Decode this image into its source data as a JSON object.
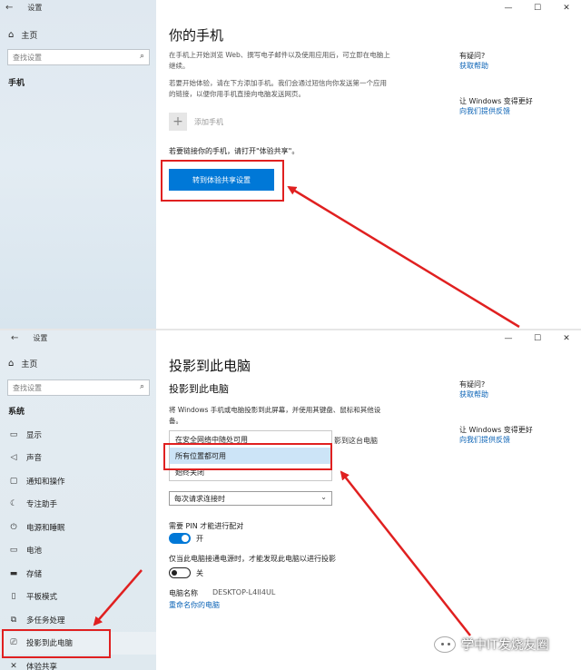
{
  "top": {
    "window_title": "设置",
    "home_label": "主页",
    "search_placeholder": "查找设置",
    "category": "手机",
    "page_title": "你的手机",
    "para1": "在手机上开始浏览 Web、撰写电子邮件以及使用应用后，可立即在电脑上继续。",
    "para2": "若要开始体验，请在下方添加手机。我们会通过短信向你发送第一个应用的链接，以便你用手机直接向电脑发送网页。",
    "add_phone_label": "添加手机",
    "share_hint": "若要链接你的手机，请打开\"体验共享\"。",
    "share_button": "转到体验共享设置",
    "help_title": "有疑问?",
    "help_link": "获取帮助",
    "feedback_title": "让 Windows 变得更好",
    "feedback_link": "向我们提供反馈"
  },
  "bottom": {
    "window_title": "设置",
    "home_label": "主页",
    "search_placeholder": "查找设置",
    "category": "系统",
    "nav_items": [
      {
        "label": "显示",
        "icon": "display-icon"
      },
      {
        "label": "声音",
        "icon": "sound-icon"
      },
      {
        "label": "通知和操作",
        "icon": "notification-icon"
      },
      {
        "label": "专注助手",
        "icon": "moon-icon"
      },
      {
        "label": "电源和睡眠",
        "icon": "power-icon"
      },
      {
        "label": "电池",
        "icon": "battery-icon"
      },
      {
        "label": "存储",
        "icon": "storage-icon"
      },
      {
        "label": "平板模式",
        "icon": "tablet-icon"
      },
      {
        "label": "多任务处理",
        "icon": "multitask-icon"
      },
      {
        "label": "投影到此电脑",
        "icon": "project-icon"
      },
      {
        "label": "体验共享",
        "icon": "share-icon"
      }
    ],
    "page_title": "投影到此电脑",
    "subtitle": "投影到此电脑",
    "description": "将 Windows 手机或电脑投影到此屏幕，并使用其键盘、鼠标和其他设备。",
    "dropdown_options": [
      "在安全网络中随处可用",
      "所有位置都可用",
      "始终关闭"
    ],
    "partial_right_text": "影到这台电脑",
    "pair_select": "每次请求连接时",
    "pin_label": "需要 PIN 才能进行配对",
    "pin_state": "开",
    "power_label": "仅当此电脑接通电源时，才能发现此电脑以进行投影",
    "power_state": "关",
    "pc_name_label": "电脑名称",
    "pc_name_value": "DESKTOP-L4II4UL",
    "rename_link": "重命名你的电脑",
    "help_title": "有疑问?",
    "help_link": "获取帮助",
    "feedback_title": "让 Windows 变得更好",
    "feedback_link": "向我们提供反馈"
  },
  "watermark": "学中IT发烧友圈",
  "colors": {
    "accent": "#0078d7",
    "link": "#0b63b6",
    "annotation": "#e02020"
  }
}
